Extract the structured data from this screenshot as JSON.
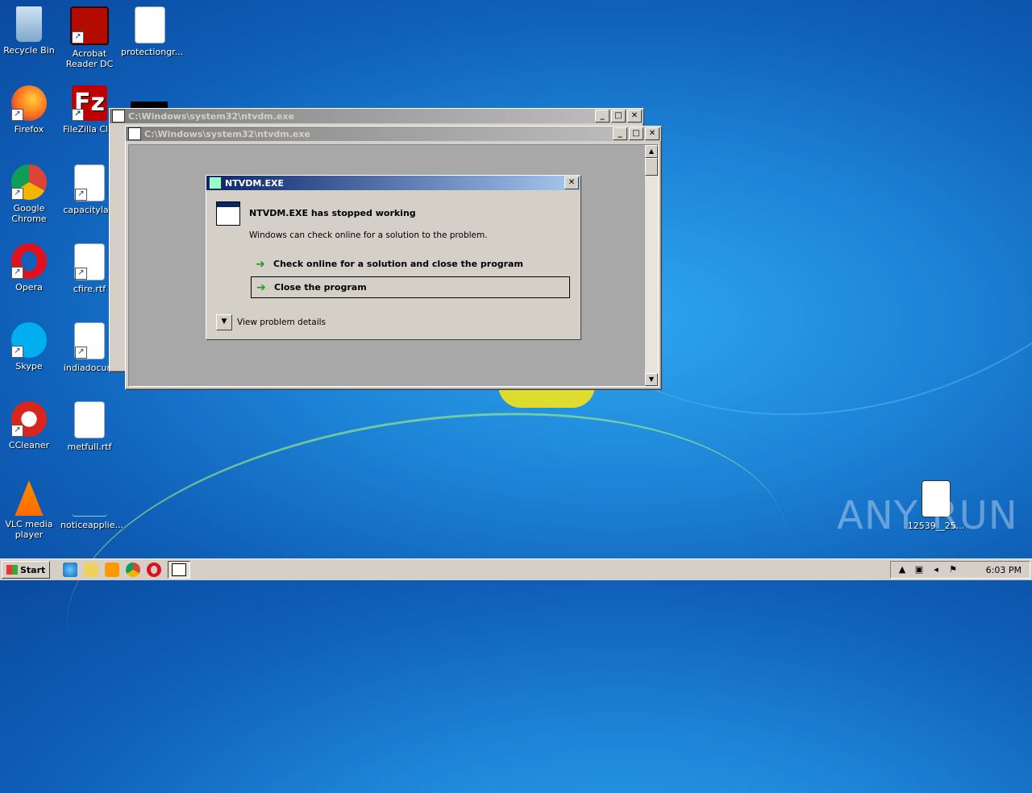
{
  "desktop": {
    "icons": [
      {
        "label": "Recycle Bin"
      },
      {
        "label": "Acrobat Reader DC"
      },
      {
        "label": "protectiongr..."
      },
      {
        "label": "Firefox"
      },
      {
        "label": "FileZilla Clie"
      },
      {
        "label": "Google Chrome"
      },
      {
        "label": "capacitylaw"
      },
      {
        "label": "Opera"
      },
      {
        "label": "cfire.rtf"
      },
      {
        "label": "Skype"
      },
      {
        "label": "indiadocum"
      },
      {
        "label": "CCleaner"
      },
      {
        "label": "metfull.rtf"
      },
      {
        "label": "VLC media player"
      },
      {
        "label": "noticeapplie..."
      },
      {
        "label": "12539__25..."
      }
    ]
  },
  "windows": {
    "back": {
      "title": "C:\\Windows\\system32\\ntvdm.exe"
    },
    "front": {
      "title": "C:\\Windows\\system32\\ntvdm.exe"
    },
    "controls": {
      "minimize": "_",
      "maximize": "□",
      "close": "✕"
    }
  },
  "dialog": {
    "title": "NTVDM.EXE",
    "heading": "NTVDM.EXE has stopped working",
    "subtext": "Windows can check online for a solution to the problem.",
    "option_check_online": "Check online for a solution and close the program",
    "option_close": "Close the program",
    "details_label": "View problem details"
  },
  "taskbar": {
    "start_label": "Start",
    "clock": "6:03 PM"
  },
  "watermark": "ANY RUN"
}
